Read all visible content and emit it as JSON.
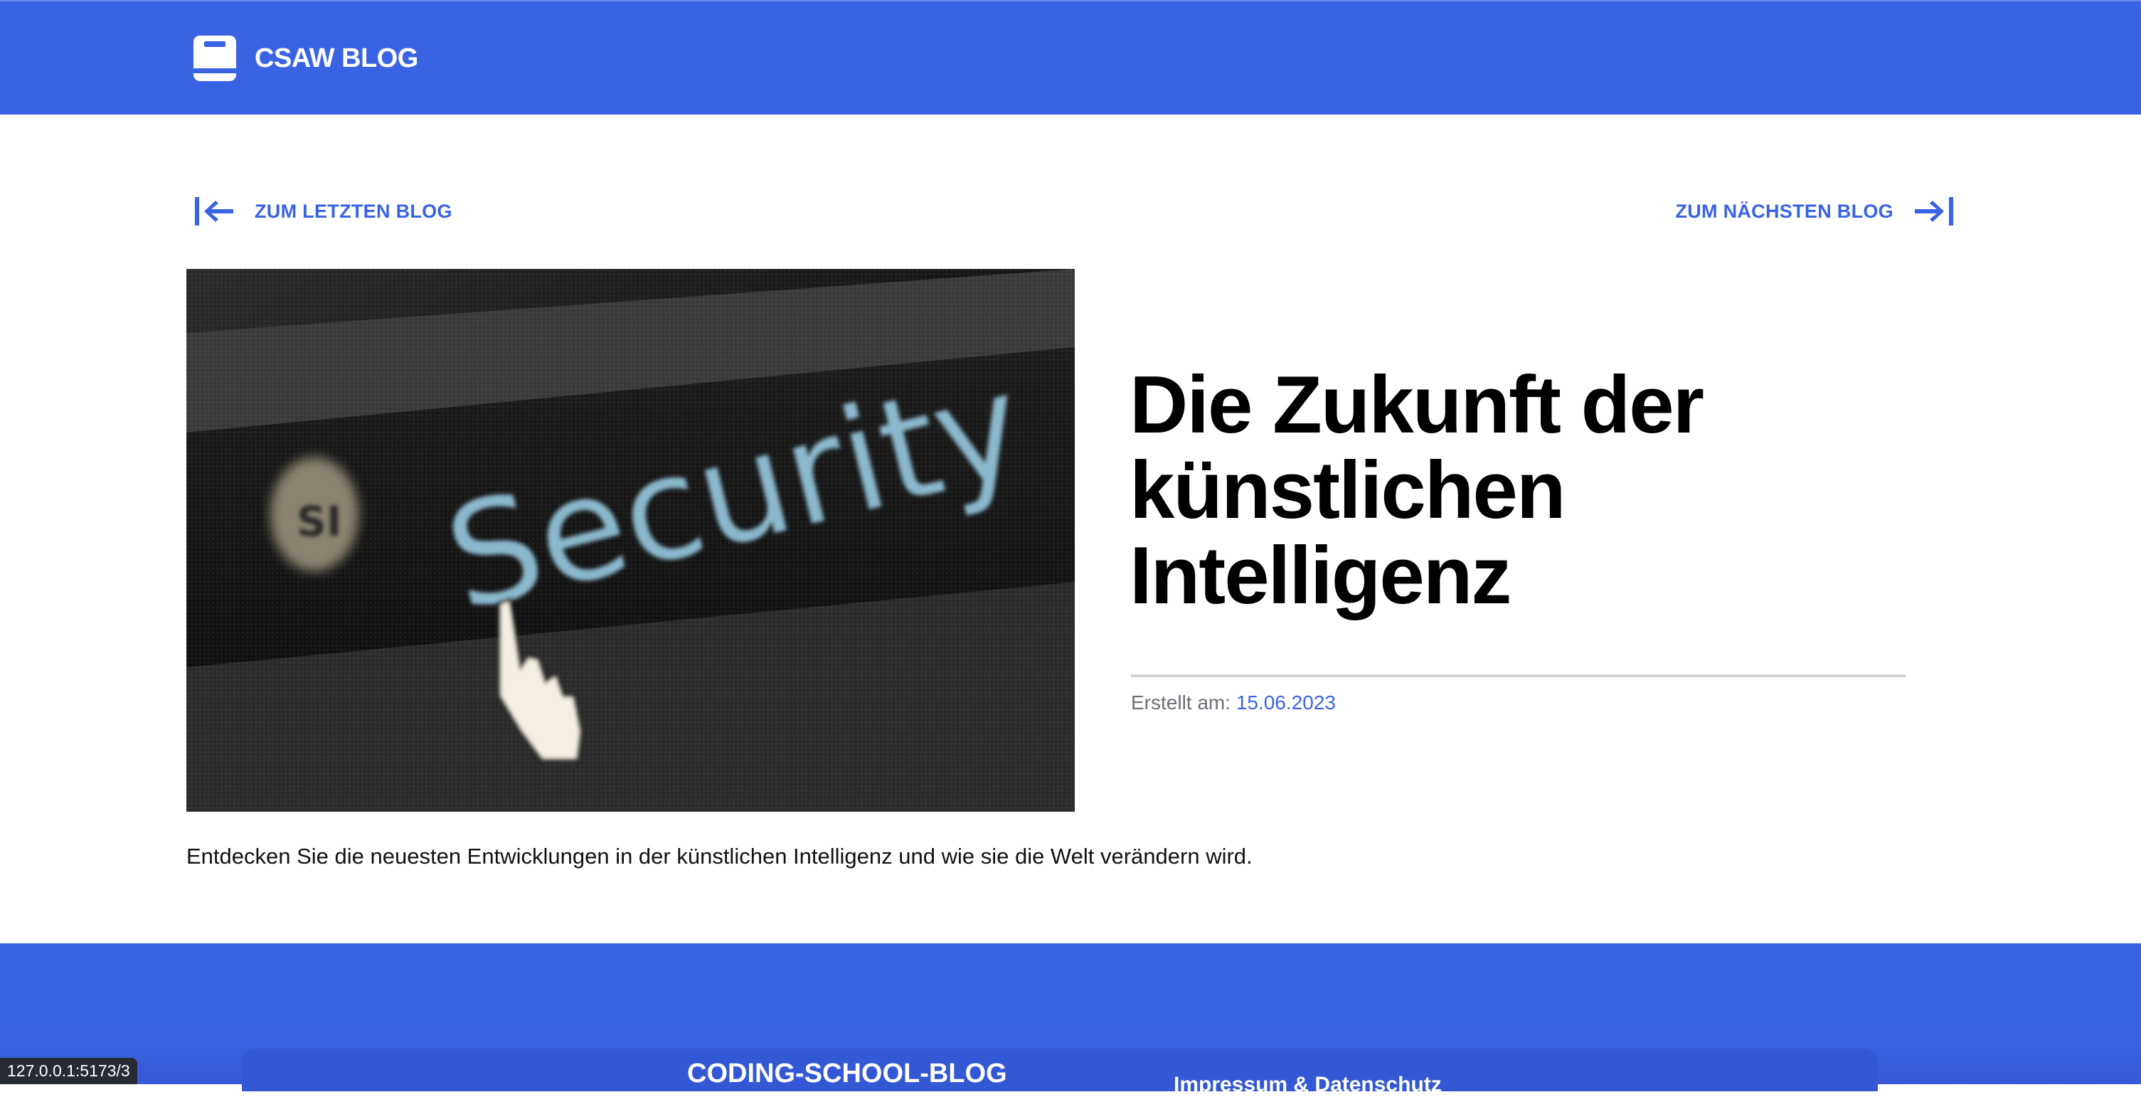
{
  "header": {
    "brand_label": "CSAW BLOG",
    "brand_icon": "book-icon",
    "background_color": "#3a63e3"
  },
  "navigation": {
    "prev_label": "ZUM LETZTEN BLOG",
    "prev_icon": "arrow-left-to-line-icon",
    "next_label": "ZUM NÄCHSTEN BLOG",
    "next_icon": "arrow-right-to-line-icon",
    "accent_color": "#3a63e3"
  },
  "post": {
    "image_word": "Security",
    "image_badge": "SI",
    "title": "Die Zukunft der künstlichen Intelligenz",
    "meta_label": "Erstellt am: ",
    "date": "15.06.2023",
    "description": "Entdecken Sie die neuesten Entwicklungen in der künstlichen Intelligenz und wie sie die Welt verändern wird."
  },
  "footer": {
    "title": "CODING-SCHOOL-BLOG",
    "subtitle": "Impressum & Datenschutz"
  },
  "status_bar": {
    "url": "127.0.0.1:5173/3"
  }
}
